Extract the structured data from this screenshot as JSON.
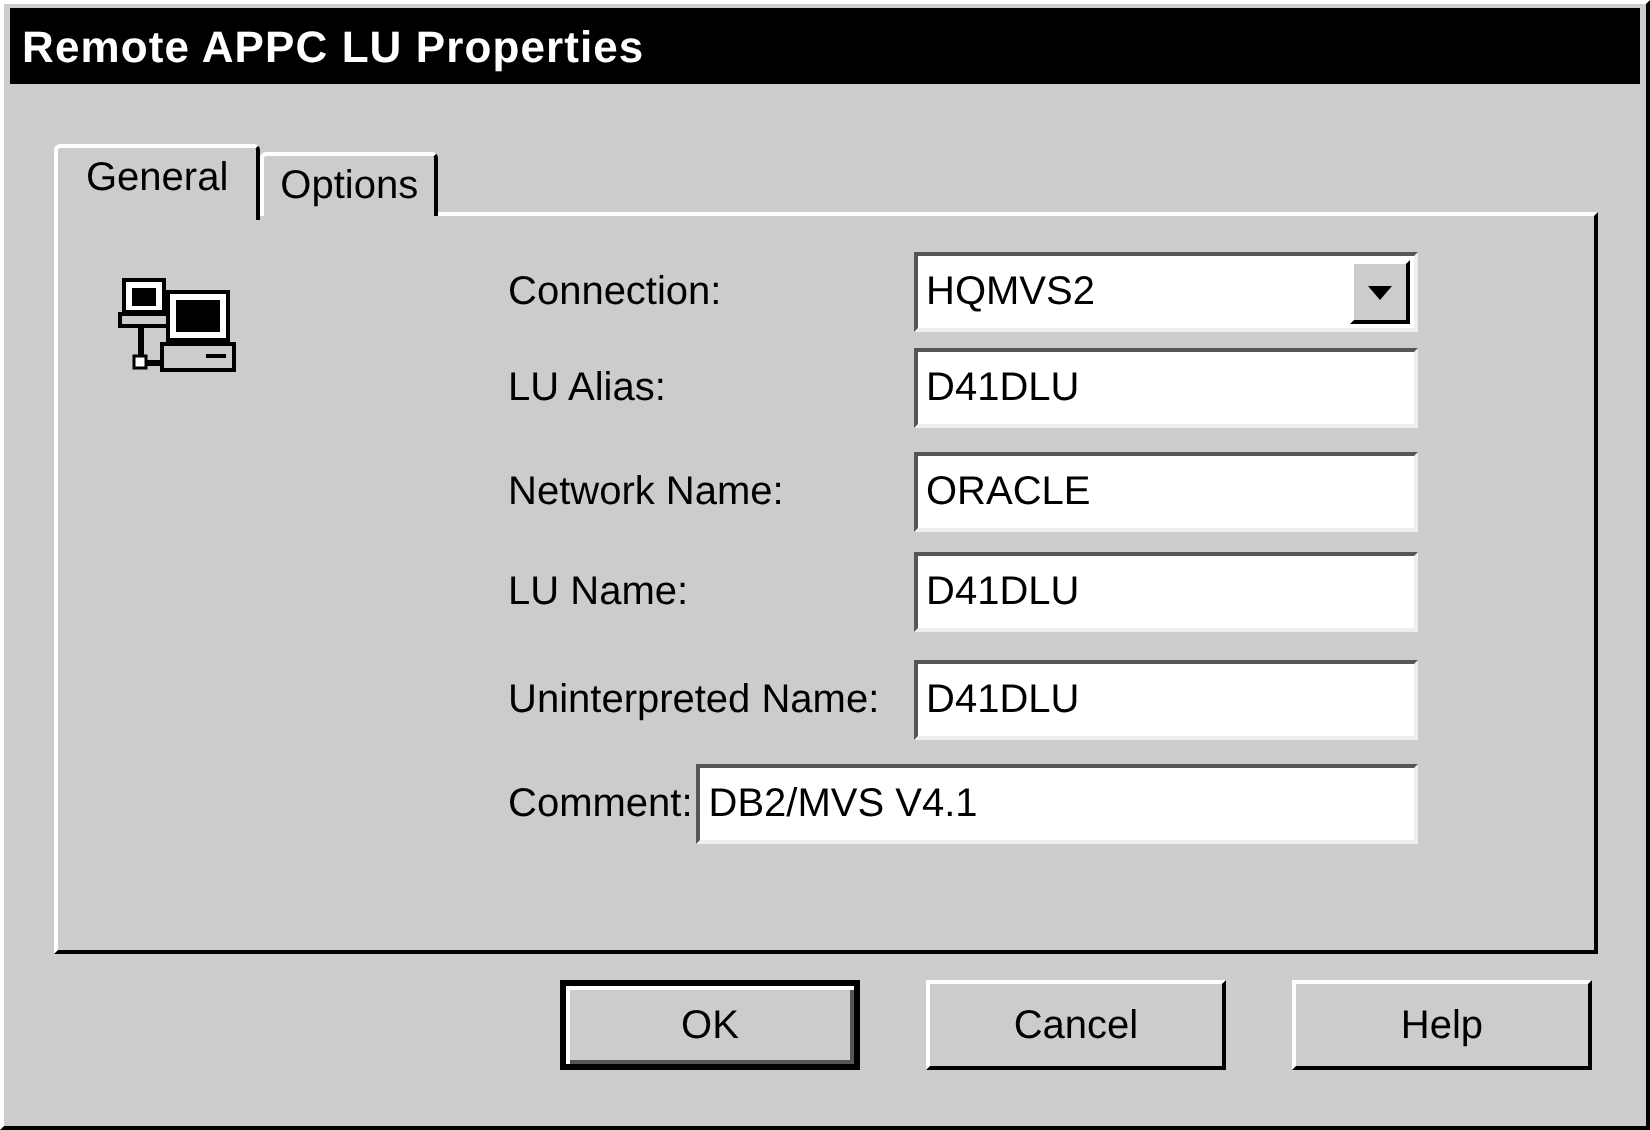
{
  "window": {
    "title": "Remote APPC LU Properties"
  },
  "tabs": [
    {
      "label": "General",
      "selected": true
    },
    {
      "label": "Options",
      "selected": false
    }
  ],
  "fields": [
    {
      "kind": "dropdown",
      "label": "Connection:",
      "value": "HQMVS2"
    },
    {
      "kind": "text",
      "label": "LU Alias:",
      "value": "D41DLU"
    },
    {
      "kind": "text",
      "label": "Network Name:",
      "value": "ORACLE"
    },
    {
      "kind": "text",
      "label": "LU Name:",
      "value": "D41DLU"
    },
    {
      "kind": "text",
      "label": "Uninterpreted Name:",
      "value": "D41DLU"
    },
    {
      "kind": "wide",
      "label": "Comment:",
      "value": "DB2/MVS V4.1"
    }
  ],
  "buttons": [
    {
      "label": "OK",
      "default": true
    },
    {
      "label": "Cancel",
      "default": false
    },
    {
      "label": "Help",
      "default": false
    }
  ]
}
